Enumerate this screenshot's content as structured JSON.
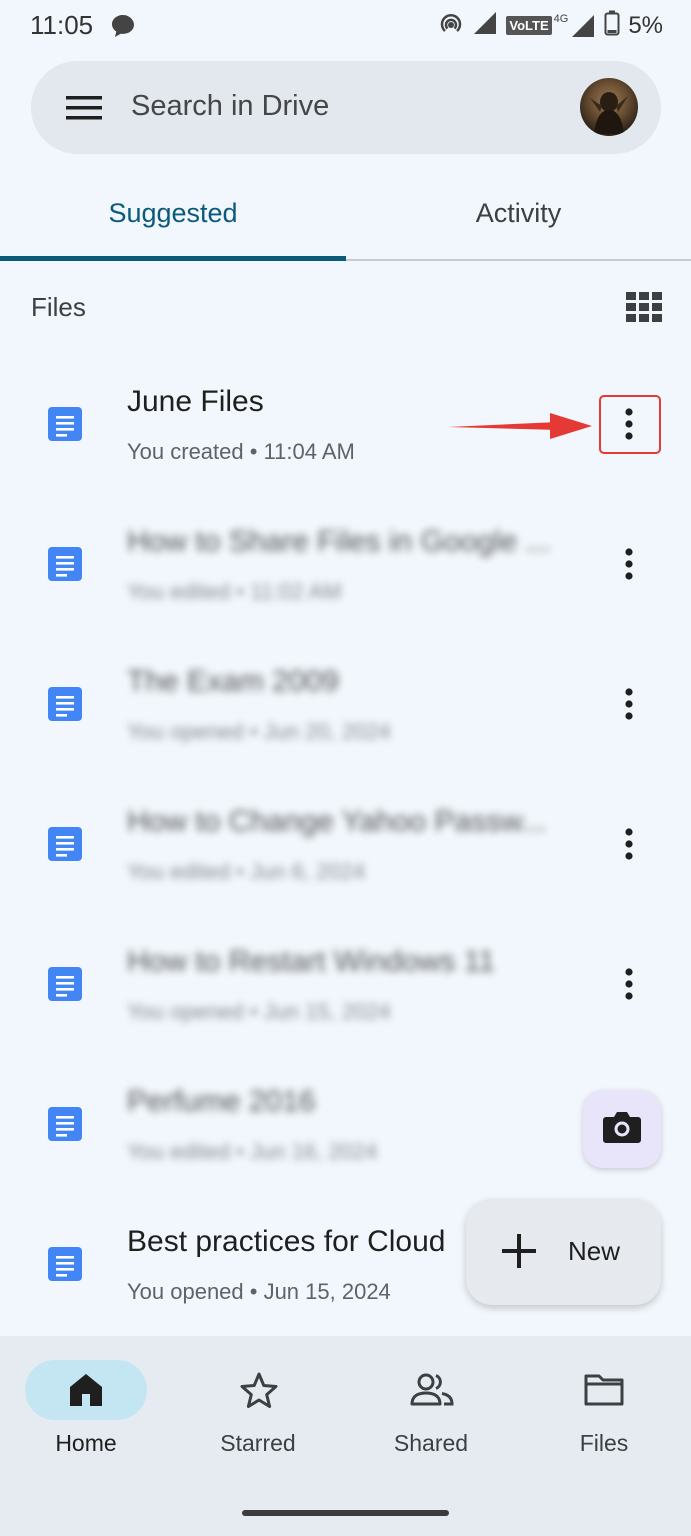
{
  "status_bar": {
    "time": "11:05",
    "battery": "5%",
    "network_label": "VoLTE",
    "network_type": "4G"
  },
  "search": {
    "placeholder": "Search in Drive"
  },
  "tabs": [
    {
      "label": "Suggested",
      "selected": true
    },
    {
      "label": "Activity",
      "selected": false
    }
  ],
  "section": {
    "title": "Files"
  },
  "files": [
    {
      "name": "June Files",
      "meta": "You created • 11:04 AM",
      "blurred": false
    },
    {
      "name": "How to Share Files in Google ...",
      "meta": "You edited • 11:02 AM",
      "blurred": true
    },
    {
      "name": "The Exam 2009",
      "meta": "You opened • Jun 20, 2024",
      "blurred": true
    },
    {
      "name": "How to Change Yahoo Passw...",
      "meta": "You edited • Jun 6, 2024",
      "blurred": true
    },
    {
      "name": "How to Restart Windows 11",
      "meta": "You opened • Jun 15, 2024",
      "blurred": true
    },
    {
      "name": "Perfume 2016",
      "meta": "You edited • Jun 16, 2024",
      "blurred": true
    },
    {
      "name": "Best practices for Cloud",
      "meta": "You opened • Jun 15, 2024",
      "blurred": false
    }
  ],
  "fab": {
    "new_label": "New"
  },
  "bottom_nav": [
    {
      "label": "Home",
      "icon": "home-icon",
      "active": true
    },
    {
      "label": "Starred",
      "icon": "star-icon",
      "active": false
    },
    {
      "label": "Shared",
      "icon": "shared-icon",
      "active": false
    },
    {
      "label": "Files",
      "icon": "folder-icon",
      "active": false
    }
  ],
  "colors": {
    "accent": "#0b5a7a",
    "doc_blue": "#4285f4",
    "highlight_red": "#e53935"
  }
}
